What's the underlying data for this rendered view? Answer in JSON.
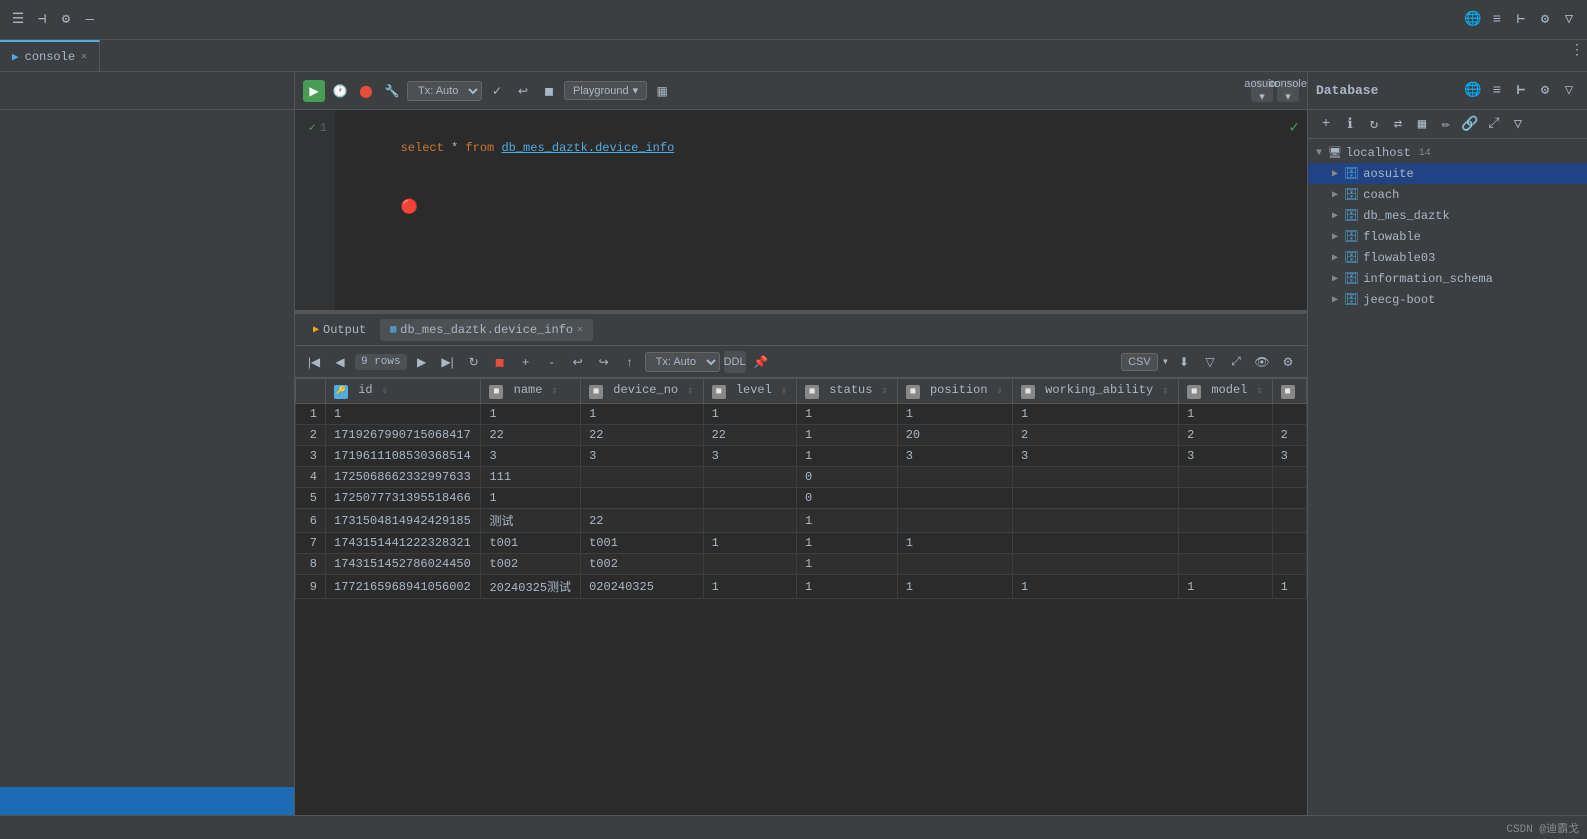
{
  "app": {
    "title": "console"
  },
  "tabs": [
    {
      "label": "console",
      "active": true,
      "icon": "sql"
    }
  ],
  "editor_toolbar": {
    "tx_label": "Tx: Auto",
    "playground_label": "Playground",
    "run_tooltip": "Run",
    "history_tooltip": "History",
    "settings_tooltip": "Settings"
  },
  "editor": {
    "line1": {
      "number": "1",
      "sql": "select * from db_mes_daztk.device_info"
    }
  },
  "database_panel": {
    "title": "Database",
    "localhost": {
      "label": "localhost",
      "count": 14
    },
    "items": [
      {
        "label": "aosuite",
        "active": true
      },
      {
        "label": "coach",
        "active": false
      },
      {
        "label": "db_mes_daztk",
        "active": false
      },
      {
        "label": "flowable",
        "active": false
      },
      {
        "label": "flowable03",
        "active": false
      },
      {
        "label": "information_schema",
        "active": false
      },
      {
        "label": "jeecg-boot",
        "active": false
      }
    ]
  },
  "output_panel": {
    "tabs": [
      {
        "label": "Output",
        "active": false,
        "icon": "output"
      },
      {
        "label": "db_mes_daztk.device_info",
        "active": true,
        "icon": "table",
        "closable": true
      }
    ],
    "toolbar": {
      "rows_label": "9 rows",
      "tx_label": "Tx: Auto",
      "ddl_label": "DDL",
      "csv_label": "CSV"
    },
    "table": {
      "columns": [
        "id",
        "name",
        "device_no",
        "level",
        "status",
        "position",
        "working_ability",
        "model"
      ],
      "rows": [
        {
          "num": 1,
          "id": "1",
          "name": "1",
          "device_no": "1",
          "level": "1",
          "status": "1",
          "position": "1",
          "working_ability": "1",
          "model": "1"
        },
        {
          "num": 2,
          "id": "1719267990715068417",
          "name": "22",
          "device_no": "22",
          "level": "22",
          "status": "1",
          "position": "20",
          "working_ability": "2",
          "model": "2",
          "extra": "2"
        },
        {
          "num": 3,
          "id": "1719611108530368514",
          "name": "3",
          "device_no": "3",
          "level": "3",
          "status": "1",
          "position": "3",
          "working_ability": "3",
          "model": "3",
          "extra": "3"
        },
        {
          "num": 4,
          "id": "1725068662332997633",
          "name": "111",
          "device_no": "",
          "level": "",
          "status": "0",
          "position": "",
          "working_ability": "",
          "model": "",
          "extra": ""
        },
        {
          "num": 5,
          "id": "1725077731395518466",
          "name": "1",
          "device_no": "",
          "level": "",
          "status": "0",
          "position": "",
          "working_ability": "",
          "model": "",
          "extra": ""
        },
        {
          "num": 6,
          "id": "1731504814942429185",
          "name": "测试",
          "device_no": "22",
          "level": "",
          "status": "1",
          "position": "",
          "working_ability": "",
          "model": "",
          "extra": ""
        },
        {
          "num": 7,
          "id": "1743151441222328321",
          "name": "t001",
          "device_no": "t001",
          "level": "1",
          "status": "1",
          "position": "1",
          "working_ability": "",
          "model": "",
          "extra": ""
        },
        {
          "num": 8,
          "id": "1743151452786024450",
          "name": "t002",
          "device_no": "t002",
          "level": "",
          "status": "1",
          "position": "",
          "working_ability": "",
          "model": "",
          "extra": ""
        },
        {
          "num": 9,
          "id": "1772165968941056002",
          "name": "20240325测试",
          "device_no": "020240325",
          "level": "1",
          "status": "1",
          "position": "1",
          "working_ability": "1",
          "model": "1",
          "extra": "1"
        }
      ]
    }
  },
  "bottom_bar": {
    "label": "CSDN @迪霸戈"
  }
}
